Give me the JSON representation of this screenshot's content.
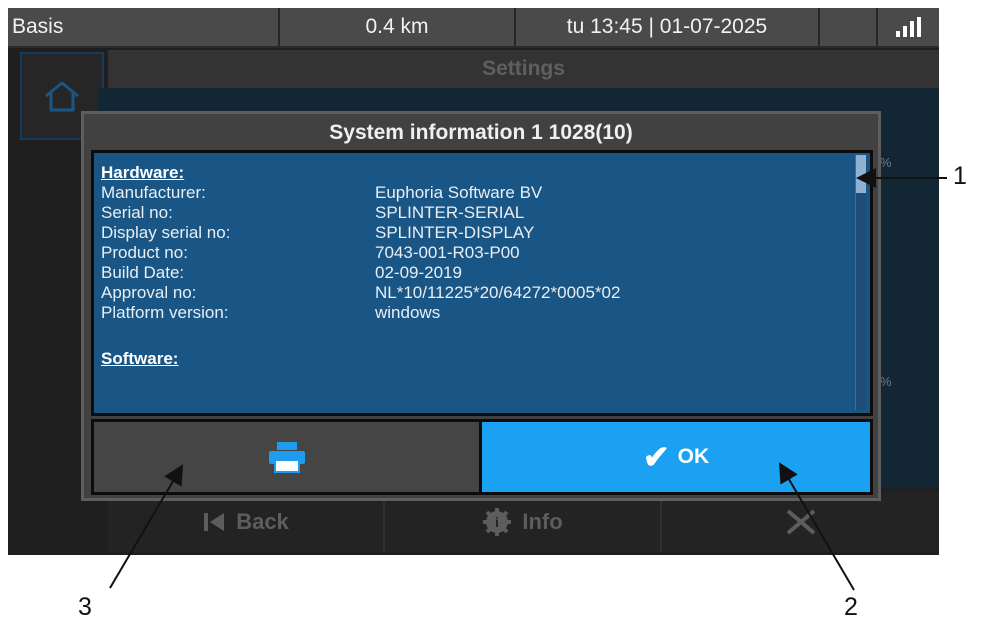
{
  "status_bar": {
    "app_label": "Basis",
    "distance": "0.4 km",
    "datetime": "tu 13:45 | 01-07-2025",
    "signal_icon": "signal-bars-icon"
  },
  "background": {
    "header_title": "Settings",
    "home_icon": "home-icon",
    "percent_markers": [
      "%",
      "%"
    ],
    "nav": {
      "back_label": "Back",
      "info_label": "Info",
      "back_icon": "skip-back-icon",
      "info_icon": "gear-info-icon",
      "x_icon": "cross-icon"
    }
  },
  "dialog": {
    "title": "System information  1 1028(10)",
    "hardware_heading": "Hardware:",
    "hardware_rows": [
      {
        "key": "Manufacturer:",
        "value": "Euphoria Software BV"
      },
      {
        "key": "Serial no:",
        "value": "SPLINTER-SERIAL"
      },
      {
        "key": "Display serial no:",
        "value": "SPLINTER-DISPLAY"
      },
      {
        "key": "Product no:",
        "value": "7043-001-R03-P00"
      },
      {
        "key": "Build Date:",
        "value": "02-09-2019"
      },
      {
        "key": "Approval no:",
        "value": "NL*10/11225*20/64272*0005*02"
      },
      {
        "key": "Platform version:",
        "value": "windows"
      }
    ],
    "software_heading": "Software:",
    "print_icon": "printer-icon",
    "ok_label": "OK",
    "ok_icon": "checkmark-icon"
  },
  "callouts": [
    "1",
    "2",
    "3"
  ],
  "colors": {
    "dialog_body": "#1a5685",
    "ok_button": "#1aa1f2",
    "printer_icon": "#1e9df0"
  }
}
